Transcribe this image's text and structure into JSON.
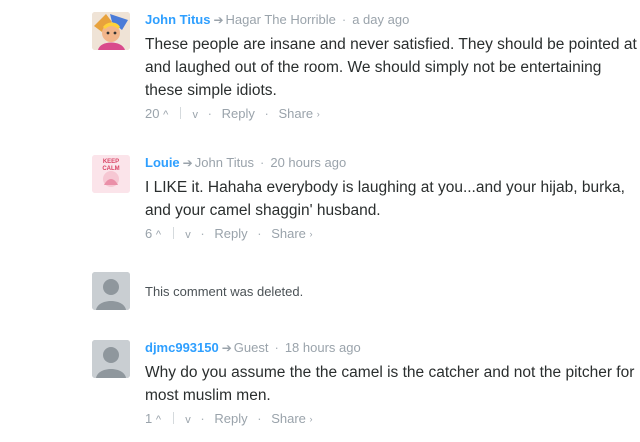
{
  "comments": [
    {
      "author": "John Titus",
      "reply_to": "Hagar The Horrible",
      "time": "a day ago",
      "text": "These people are insane and never satisfied. They should be pointed at and laughed out of the room. We should simply not be entertaining these simple idiots.",
      "votes": "20",
      "reply": "Reply",
      "share": "Share"
    },
    {
      "author": "Louie",
      "reply_to": "John Titus",
      "time": "20 hours ago",
      "text": "I LIKE it. Hahaha everybody is laughing at you...and your hijab, burka, and your camel shaggin' husband.",
      "votes": "6",
      "reply": "Reply",
      "share": "Share"
    },
    {
      "deleted_text": "This comment was deleted."
    },
    {
      "author": "djmc993150",
      "reply_to": "Guest",
      "time": "18 hours ago",
      "text": "Why do you assume the the camel is the catcher and not the pitcher for most muslim men.",
      "votes": "1",
      "reply": "Reply",
      "share": "Share"
    }
  ],
  "avatar_texts": {
    "louie": "KEEP CALM"
  },
  "colors": {
    "author": "#2e9fff",
    "meta": "#9aa3ab",
    "text": "#2a2e2e"
  }
}
